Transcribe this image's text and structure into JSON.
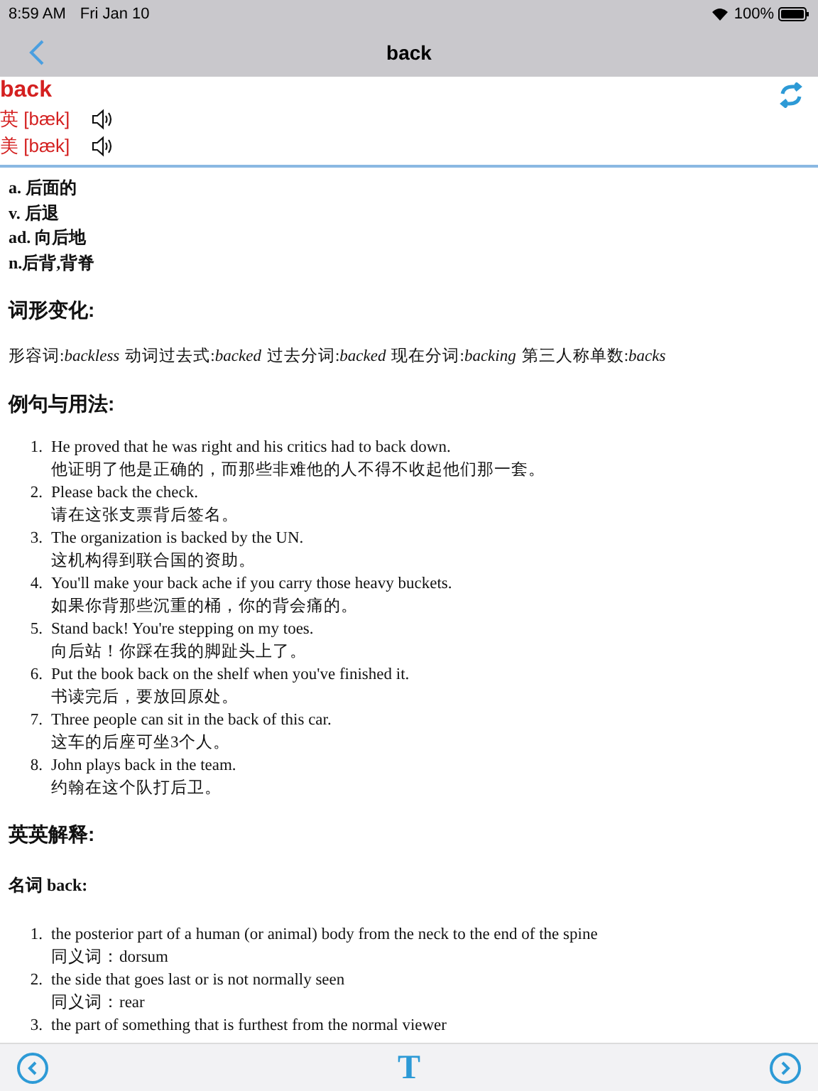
{
  "status_bar": {
    "time": "8:59 AM",
    "date": "Fri Jan 10",
    "battery": "100%"
  },
  "nav_bar": {
    "title": "back"
  },
  "entry": {
    "word": "back",
    "pronunciations": [
      {
        "label": "英 [bæk]"
      },
      {
        "label": "美 [bæk]"
      }
    ]
  },
  "meanings": [
    "a. 后面的",
    "v. 后退",
    "ad. 向后地",
    "n.后背,背脊"
  ],
  "inflections": {
    "heading": "词形变化:",
    "items": [
      {
        "label": "形容词:",
        "word": "backless"
      },
      {
        "label": "动词过去式:",
        "word": "backed"
      },
      {
        "label": "过去分词:",
        "word": "backed"
      },
      {
        "label": "现在分词:",
        "word": "backing"
      },
      {
        "label": "第三人称单数:",
        "word": "backs"
      }
    ]
  },
  "examples": {
    "heading": "例句与用法:",
    "items": [
      {
        "number": "1.",
        "english": "He proved that he was right and his critics had to back down.",
        "chinese": "他证明了他是正确的，而那些非难他的人不得不收起他们那一套。"
      },
      {
        "number": "2.",
        "english": "Please back the check.",
        "chinese": "请在这张支票背后签名。"
      },
      {
        "number": "3.",
        "english": "The organization is backed by the UN.",
        "chinese": "这机构得到联合国的资助。"
      },
      {
        "number": "4.",
        "english": "You'll make your back ache if you carry those heavy buckets.",
        "chinese": "如果你背那些沉重的桶，你的背会痛的。"
      },
      {
        "number": "5.",
        "english": "Stand back! You're stepping on my toes.",
        "chinese": "向后站！你踩在我的脚趾头上了。"
      },
      {
        "number": "6.",
        "english": "Put the book back on the shelf when you've finished it.",
        "chinese": "书读完后，要放回原处。"
      },
      {
        "number": "7.",
        "english": "Three people can sit in the back of this car.",
        "chinese": "这车的后座可坐3个人。"
      },
      {
        "number": "8.",
        "english": "John plays back in the team.",
        "chinese": "约翰在这个队打后卫。"
      }
    ]
  },
  "english_definitions": {
    "heading": "英英解释:",
    "subheading": "名词 back:",
    "items": [
      {
        "number": "1.",
        "definition": "the posterior part of a human (or animal) body from the neck to the end of the spine",
        "synonym": "同义词：dorsum"
      },
      {
        "number": "2.",
        "definition": "the side that goes last or is not normally seen",
        "synonym": "同义词：rear"
      },
      {
        "number": "3.",
        "definition": "the part of something that is furthest from the normal viewer"
      }
    ]
  },
  "toolbar": {
    "font_button": "T"
  }
}
